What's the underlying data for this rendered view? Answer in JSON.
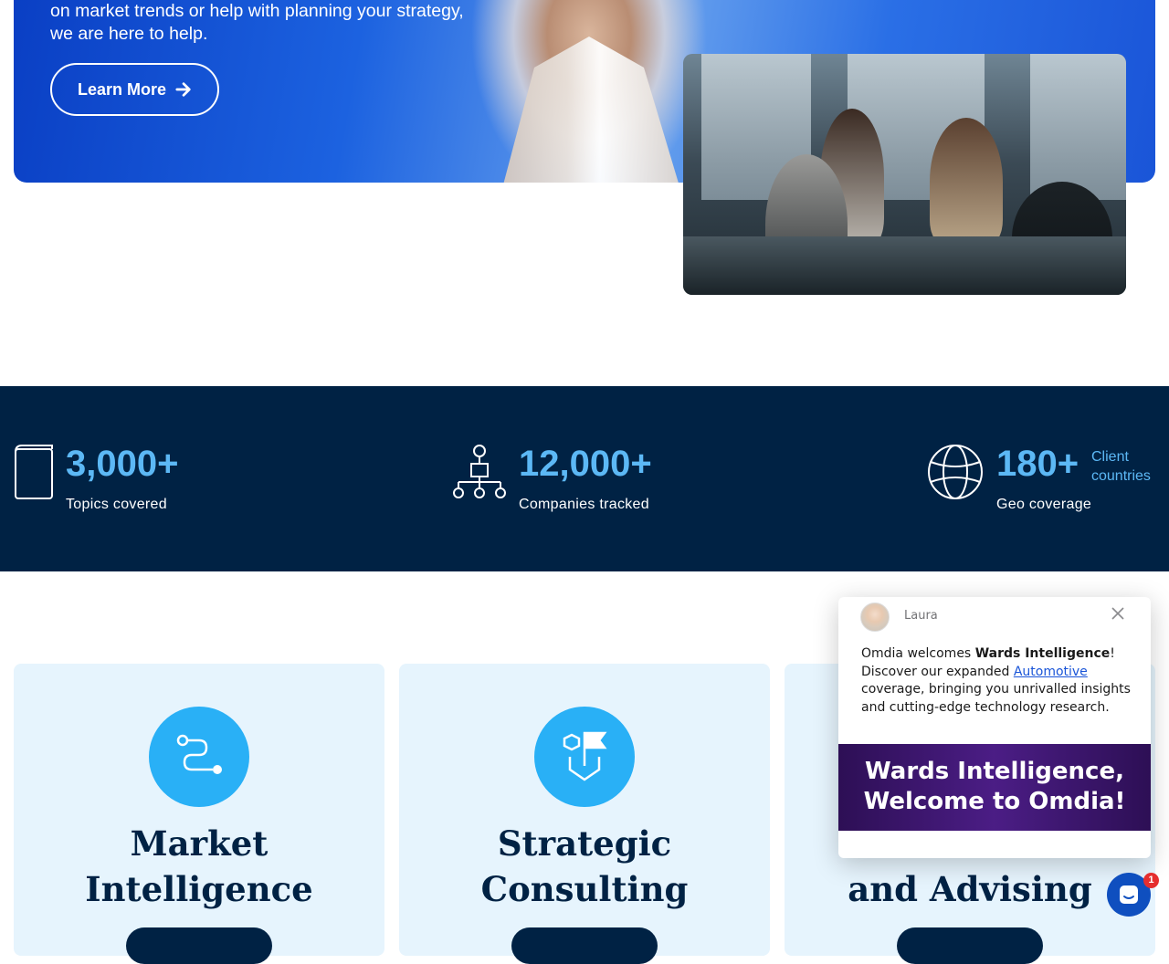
{
  "hero": {
    "text_line1": "on market trends or help with planning your strategy,",
    "text_line2": "we are here to help.",
    "learn_more_label": "Learn More"
  },
  "stats": [
    {
      "value": "3,000+",
      "label": "Topics covered",
      "icon": "book-icon"
    },
    {
      "value": "12,000+",
      "label": "Companies tracked",
      "icon": "org-chart-icon"
    },
    {
      "value": "180+",
      "label": "Geo coverage",
      "side_line1": "Client",
      "side_line2": "countries",
      "icon": "globe-icon"
    }
  ],
  "cards": [
    {
      "title_line1": "Market",
      "title_line2": "Intelligence",
      "icon": "route-icon"
    },
    {
      "title_line1": "Strategic",
      "title_line2": "Consulting",
      "icon": "shield-flag-icon"
    },
    {
      "title_line2": "and Advising"
    }
  ],
  "chat": {
    "agent_name": "Laura",
    "msg_prefix": "Omdia welcomes ",
    "msg_bold": "Wards Intelligence",
    "msg_after_bold": "!",
    "msg_line2_prefix": "Discover our expanded ",
    "msg_link": "Automotive",
    "msg_rest": "coverage, bringing you unrivalled insights and cutting-edge technology research.",
    "banner_line1": "Wards Intelligence,",
    "banner_line2": "Welcome to Omdia!"
  },
  "launcher": {
    "badge_count": "1"
  },
  "colors": {
    "navy": "#002244",
    "accent_blue": "#5cb8f5",
    "icon_circle": "#29b0f6",
    "card_bg": "#e6f4fd",
    "banner_purple": "#4b1d85"
  }
}
